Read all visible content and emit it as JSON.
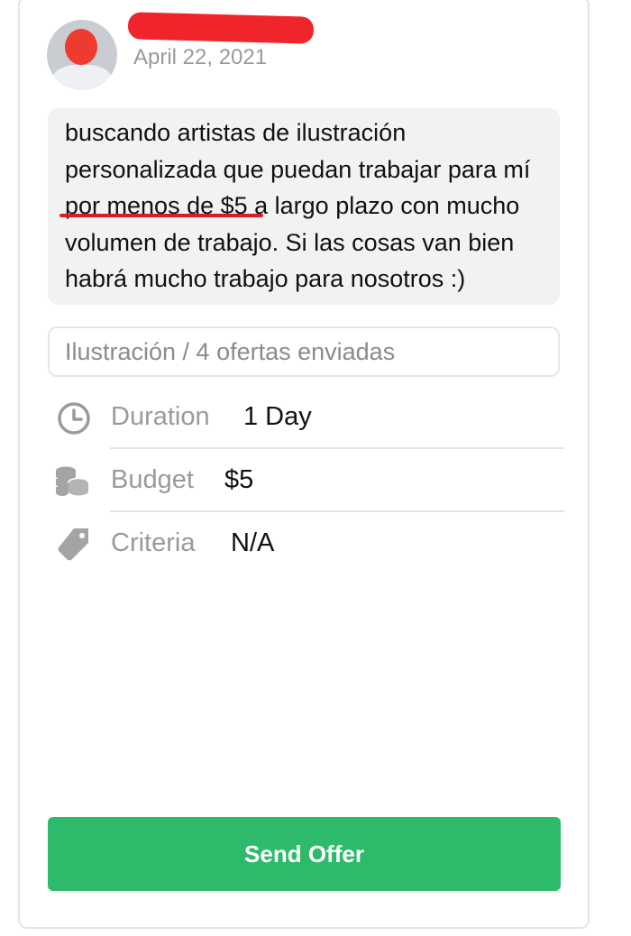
{
  "post": {
    "date": "April 22, 2021",
    "message": "buscando artistas de ilustración\npersonalizada que puedan trabajar para mí\npor menos de $5 a largo plazo con mucho\nvolumen de trabajo. Si las cosas van bien\nhabrá mucho trabajo para nosotros :)"
  },
  "category_field": {
    "text": "Ilustración / 4 ofertas enviadas"
  },
  "details": [
    {
      "icon": "clock-icon",
      "label": "Duration",
      "value": "1 Day"
    },
    {
      "icon": "coins-icon",
      "label": "Budget",
      "value": "$5"
    },
    {
      "icon": "tag-icon",
      "label": "Criteria",
      "value": "N/A"
    }
  ],
  "actions": {
    "send_offer_label": "Send Offer"
  },
  "colors": {
    "accent_green": "#2dbb6b",
    "redaction_red": "#f0252b",
    "underline_red": "#d81e25",
    "bubble_gray": "#f2f2f2"
  }
}
